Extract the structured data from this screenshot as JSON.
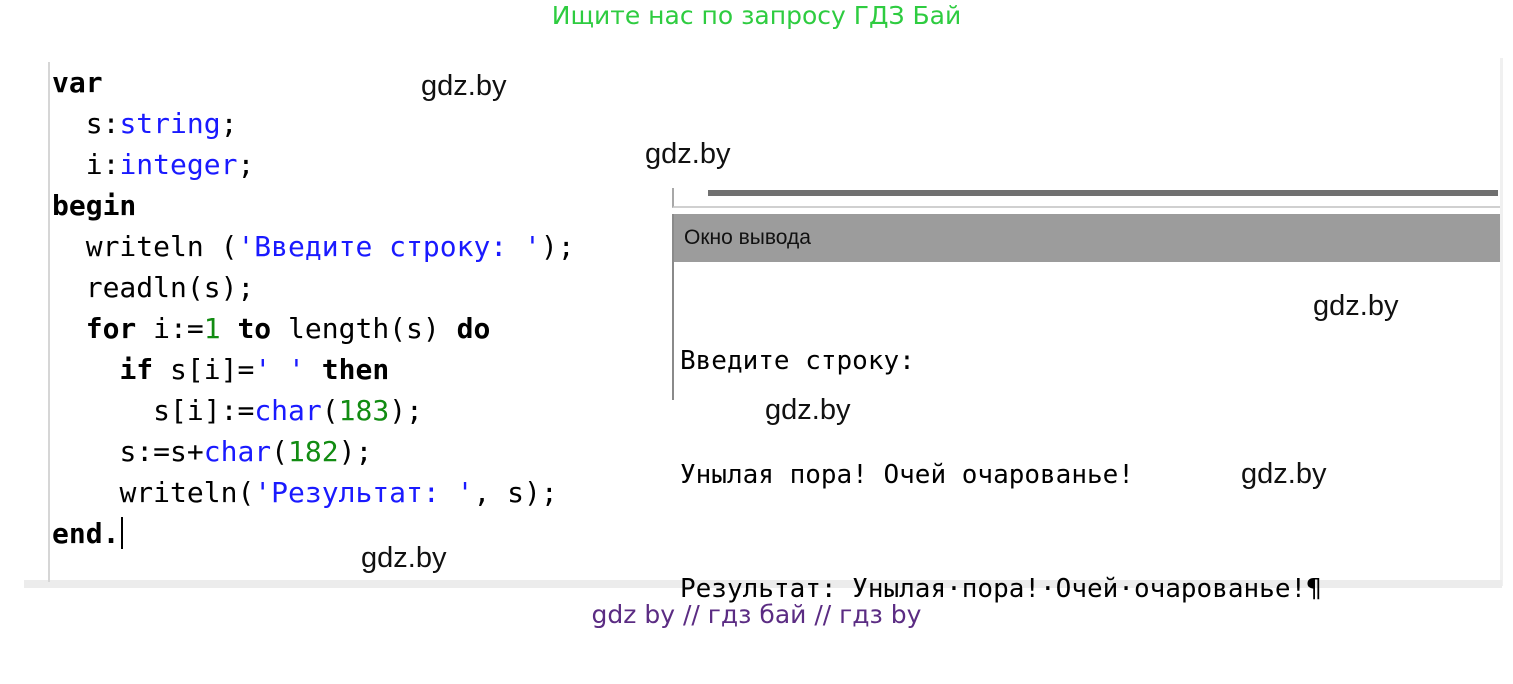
{
  "banner": "Ищите нас по запросу ГДЗ Бай",
  "editor": {
    "lines": [
      {
        "indent": "",
        "tokens": [
          {
            "t": "var",
            "c": "kw"
          }
        ]
      },
      {
        "indent": "  ",
        "tokens": [
          {
            "t": "s:",
            "c": ""
          },
          {
            "t": "string",
            "c": "ty"
          },
          {
            "t": ";",
            "c": ""
          }
        ]
      },
      {
        "indent": "  ",
        "tokens": [
          {
            "t": "i:",
            "c": ""
          },
          {
            "t": "integer",
            "c": "ty"
          },
          {
            "t": ";",
            "c": ""
          }
        ]
      },
      {
        "indent": "",
        "tokens": [
          {
            "t": "begin",
            "c": "kw"
          }
        ]
      },
      {
        "indent": "  ",
        "tokens": [
          {
            "t": "writeln (",
            "c": ""
          },
          {
            "t": "'Введите строку: '",
            "c": "st"
          },
          {
            "t": ");",
            "c": ""
          }
        ]
      },
      {
        "indent": "  ",
        "tokens": [
          {
            "t": "readln(s);",
            "c": ""
          }
        ]
      },
      {
        "indent": "  ",
        "tokens": [
          {
            "t": "for",
            "c": "kw"
          },
          {
            "t": " i:=",
            "c": ""
          },
          {
            "t": "1",
            "c": "nm"
          },
          {
            "t": " ",
            "c": ""
          },
          {
            "t": "to",
            "c": "kw"
          },
          {
            "t": " length(s) ",
            "c": ""
          },
          {
            "t": "do",
            "c": "kw"
          }
        ]
      },
      {
        "indent": "    ",
        "tokens": [
          {
            "t": "if",
            "c": "kw"
          },
          {
            "t": " s[i]=",
            "c": ""
          },
          {
            "t": "' '",
            "c": "st"
          },
          {
            "t": " ",
            "c": ""
          },
          {
            "t": "then",
            "c": "kw"
          }
        ]
      },
      {
        "indent": "      ",
        "tokens": [
          {
            "t": "s[i]:=",
            "c": ""
          },
          {
            "t": "char",
            "c": "ty"
          },
          {
            "t": "(",
            "c": ""
          },
          {
            "t": "183",
            "c": "nm"
          },
          {
            "t": ");",
            "c": ""
          }
        ]
      },
      {
        "indent": "    ",
        "tokens": [
          {
            "t": "s:=s+",
            "c": ""
          },
          {
            "t": "char",
            "c": "ty"
          },
          {
            "t": "(",
            "c": ""
          },
          {
            "t": "182",
            "c": "nm"
          },
          {
            "t": ");",
            "c": ""
          }
        ]
      },
      {
        "indent": "    ",
        "tokens": [
          {
            "t": "writeln(",
            "c": ""
          },
          {
            "t": "'Результат: '",
            "c": "st"
          },
          {
            "t": ", s);",
            "c": ""
          }
        ]
      },
      {
        "indent": "",
        "tokens": [
          {
            "t": "end.",
            "c": "kw"
          }
        ],
        "caret": true
      }
    ]
  },
  "output": {
    "title": "Окно вывода",
    "lines": [
      "Введите строку:",
      "Унылая пора! Очей очарованье!",
      "Результат: Унылая·пора!·Очей·очарованье!¶"
    ]
  },
  "watermark": "gdz.by",
  "footer": "gdz by  //  гдз бай  //  гдз by",
  "colors": {
    "banner": "#2ecc40",
    "footer": "#5b2c83",
    "keyword_type": "#1a1aff",
    "number": "#128c12",
    "output_title_bar": "#9c9c9c"
  }
}
